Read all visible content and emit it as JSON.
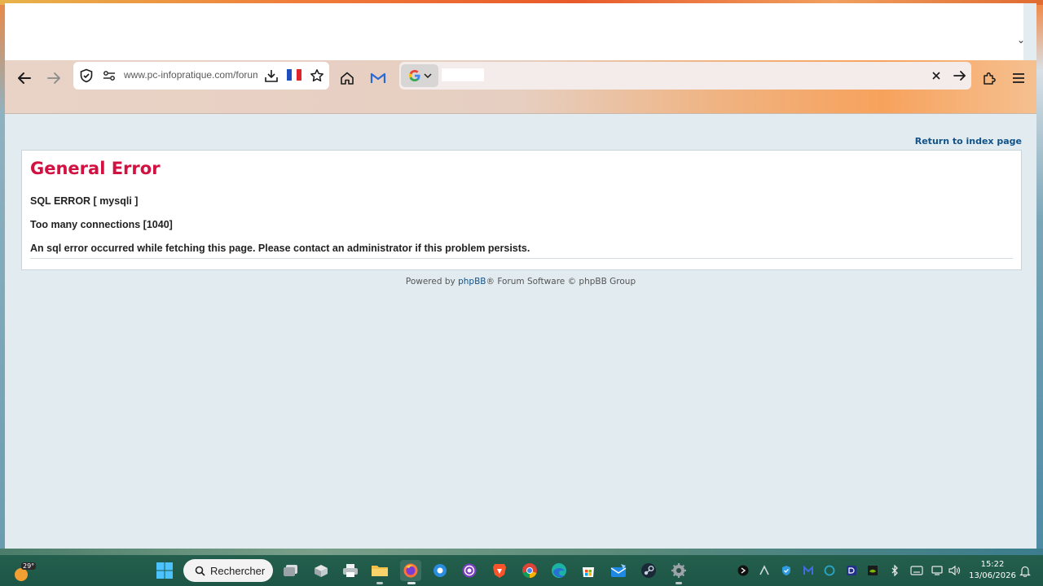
{
  "browser": {
    "url": "www.pc-infopratique.com/forum",
    "search_engine": "Google",
    "icons": [
      "back-arrow-icon",
      "forward-arrow-icon",
      "shield-icon",
      "permissions-icon",
      "save-page-icon",
      "france-flag-icon",
      "bookmark-star-icon",
      "home-icon",
      "gmail-icon",
      "google-icon",
      "clear-icon",
      "go-arrow-icon",
      "extensions-icon",
      "menu-icon"
    ]
  },
  "page": {
    "return_link": "Return to index page",
    "error_title": "General Error",
    "sql_error": "SQL ERROR [ mysqli ]",
    "connections": "Too many connections [1040]",
    "message": "An sql error occurred while fetching this page. Please contact an administrator if this problem persists.",
    "footer": {
      "powered_by": "Powered by ",
      "phpbb": "phpBB",
      "rest": "® Forum Software © phpBB Group"
    },
    "colors": {
      "error_title": "#d31141",
      "link": "#105289",
      "page_bg": "#e2ecf0"
    }
  },
  "taskbar": {
    "weather_temp": "29°",
    "search_label": "Rechercher",
    "time": "15:22",
    "date": "13/06/2026"
  }
}
